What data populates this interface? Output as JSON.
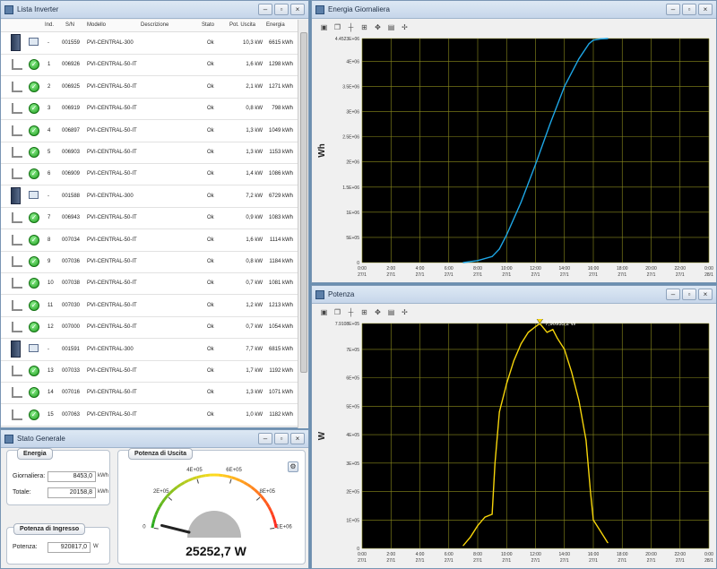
{
  "list_window": {
    "title": "Lista Inverter",
    "columns": {
      "ind": "Ind.",
      "sn": "S/N",
      "modello": "Modello",
      "descrizione": "Descrizione",
      "stato": "Stato",
      "pot": "Pot. Uscita",
      "energia": "Energia"
    },
    "rows": [
      {
        "type": "central",
        "ind": "-",
        "sn": "001559",
        "modello": "PVI-CENTRAL-300",
        "stato": "Ok",
        "pot": "10,3 kW",
        "energia": "6615 kWh"
      },
      {
        "type": "module",
        "ind": "1",
        "sn": "006926",
        "modello": "PVI-CENTRAL-50-IT",
        "stato": "Ok",
        "pot": "1,6 kW",
        "energia": "1298 kWh"
      },
      {
        "type": "module",
        "ind": "2",
        "sn": "006925",
        "modello": "PVI-CENTRAL-50-IT",
        "stato": "Ok",
        "pot": "2,1 kW",
        "energia": "1271 kWh"
      },
      {
        "type": "module",
        "ind": "3",
        "sn": "006919",
        "modello": "PVI-CENTRAL-50-IT",
        "stato": "Ok",
        "pot": "0,8 kW",
        "energia": "798 kWh"
      },
      {
        "type": "module",
        "ind": "4",
        "sn": "006897",
        "modello": "PVI-CENTRAL-50-IT",
        "stato": "Ok",
        "pot": "1,3 kW",
        "energia": "1049 kWh"
      },
      {
        "type": "module",
        "ind": "5",
        "sn": "006903",
        "modello": "PVI-CENTRAL-50-IT",
        "stato": "Ok",
        "pot": "1,3 kW",
        "energia": "1153 kWh"
      },
      {
        "type": "module",
        "ind": "6",
        "sn": "006909",
        "modello": "PVI-CENTRAL-50-IT",
        "stato": "Ok",
        "pot": "1,4 kW",
        "energia": "1086 kWh"
      },
      {
        "type": "central",
        "ind": "-",
        "sn": "001588",
        "modello": "PVI-CENTRAL-300",
        "stato": "Ok",
        "pot": "7,2 kW",
        "energia": "6729 kWh"
      },
      {
        "type": "module",
        "ind": "7",
        "sn": "006943",
        "modello": "PVI-CENTRAL-50-IT",
        "stato": "Ok",
        "pot": "0,9 kW",
        "energia": "1083 kWh"
      },
      {
        "type": "module",
        "ind": "8",
        "sn": "007034",
        "modello": "PVI-CENTRAL-50-IT",
        "stato": "Ok",
        "pot": "1,6 kW",
        "energia": "1114 kWh"
      },
      {
        "type": "module",
        "ind": "9",
        "sn": "007036",
        "modello": "PVI-CENTRAL-50-IT",
        "stato": "Ok",
        "pot": "0,8 kW",
        "energia": "1184 kWh"
      },
      {
        "type": "module",
        "ind": "10",
        "sn": "007038",
        "modello": "PVI-CENTRAL-50-IT",
        "stato": "Ok",
        "pot": "0,7 kW",
        "energia": "1081 kWh"
      },
      {
        "type": "module",
        "ind": "11",
        "sn": "007030",
        "modello": "PVI-CENTRAL-50-IT",
        "stato": "Ok",
        "pot": "1,2 kW",
        "energia": "1213 kWh"
      },
      {
        "type": "module",
        "ind": "12",
        "sn": "007000",
        "modello": "PVI-CENTRAL-50-IT",
        "stato": "Ok",
        "pot": "0,7 kW",
        "energia": "1054 kWh"
      },
      {
        "type": "central",
        "ind": "-",
        "sn": "001591",
        "modello": "PVI-CENTRAL-300",
        "stato": "Ok",
        "pot": "7,7 kW",
        "energia": "6815 kWh"
      },
      {
        "type": "module",
        "ind": "13",
        "sn": "007033",
        "modello": "PVI-CENTRAL-50-IT",
        "stato": "Ok",
        "pot": "1,7 kW",
        "energia": "1192 kWh"
      },
      {
        "type": "module",
        "ind": "14",
        "sn": "007016",
        "modello": "PVI-CENTRAL-50-IT",
        "stato": "Ok",
        "pot": "1,3 kW",
        "energia": "1071 kWh"
      },
      {
        "type": "module",
        "ind": "15",
        "sn": "007063",
        "modello": "PVI-CENTRAL-50-IT",
        "stato": "Ok",
        "pot": "1,0 kW",
        "energia": "1182 kWh"
      }
    ]
  },
  "stato_window": {
    "title": "Stato Generale",
    "energia": {
      "title": "Energia",
      "giornaliera_label": "Giornaliera:",
      "giornaliera_value": "8453,0",
      "giornaliera_unit": "kWh",
      "totale_label": "Totale:",
      "totale_value": "20158,8",
      "totale_unit": "kWh"
    },
    "ingresso": {
      "title": "Potenza di Ingresso",
      "potenza_label": "Potenza:",
      "potenza_value": "920817,0",
      "potenza_unit": "W"
    },
    "uscita": {
      "title": "Potenza di Uscita",
      "value_label": "25252,7 W",
      "gauge_value": 25252.7,
      "gauge_min": 0,
      "gauge_max": 1000000,
      "tick_labels": [
        "0",
        "2E+05",
        "4E+05",
        "6E+05",
        "8E+05",
        "1E+06"
      ]
    }
  },
  "energia_window": {
    "title": "Energia Giornaliera"
  },
  "potenza_window": {
    "title": "Potenza"
  },
  "chart_data": [
    {
      "type": "line",
      "ylabel": "Wh",
      "xlim": [
        "0:00 27/1",
        "0:00 28/1"
      ],
      "ylim": [
        0,
        4452300
      ],
      "y_tick_labels": [
        "4.4523E+06",
        "4E+06",
        "3.5E+06",
        "3E+06",
        "2.5E+06",
        "2E+06",
        "1.5E+06",
        "1E+06",
        "5E+05",
        "0"
      ],
      "x_tick_labels": [
        [
          "0:00",
          "27/1"
        ],
        [
          "2:00",
          "27/1"
        ],
        [
          "4:00",
          "27/1"
        ],
        [
          "6:00",
          "27/1"
        ],
        [
          "8:00",
          "27/1"
        ],
        [
          "10:00",
          "27/1"
        ],
        [
          "12:00",
          "27/1"
        ],
        [
          "14:00",
          "27/1"
        ],
        [
          "16:00",
          "27/1"
        ],
        [
          "18:00",
          "27/1"
        ],
        [
          "20:00",
          "27/1"
        ],
        [
          "22:00",
          "27/1"
        ],
        [
          "0:00",
          "28/1"
        ]
      ],
      "grid": true,
      "color": "#1ea7e6",
      "series": [
        {
          "x": [
            7.0,
            8.0,
            9.0,
            9.5,
            10.0,
            11.0,
            12.0,
            13.0,
            14.0,
            15.0,
            15.7,
            16.0,
            16.5,
            17.0
          ],
          "y": [
            0,
            40000,
            120000,
            270000,
            550000,
            1200000,
            1950000,
            2750000,
            3500000,
            4050000,
            4350000,
            4420000,
            4445000,
            4452300
          ]
        }
      ]
    },
    {
      "type": "line",
      "ylabel": "W",
      "xlim": [
        "0:00 27/1",
        "0:00 28/1"
      ],
      "ylim": [
        0,
        791080
      ],
      "y_tick_labels": [
        "7.9108E+05",
        "7E+05",
        "6E+05",
        "5E+05",
        "4E+05",
        "3E+05",
        "2E+05",
        "1E+05",
        "0"
      ],
      "x_tick_labels": [
        [
          "0:00",
          "27/1"
        ],
        [
          "2:00",
          "27/1"
        ],
        [
          "4:00",
          "27/1"
        ],
        [
          "6:00",
          "27/1"
        ],
        [
          "8:00",
          "27/1"
        ],
        [
          "10:00",
          "27/1"
        ],
        [
          "12:00",
          "27/1"
        ],
        [
          "14:00",
          "27/1"
        ],
        [
          "16:00",
          "27/1"
        ],
        [
          "18:00",
          "27/1"
        ],
        [
          "20:00",
          "27/1"
        ],
        [
          "22:00",
          "27/1"
        ],
        [
          "0:00",
          "28/1"
        ]
      ],
      "grid": true,
      "color": "#f5d40a",
      "marker_label": "7,90935,2 W",
      "series": [
        {
          "x": [
            7.0,
            7.5,
            8.0,
            8.5,
            9.0,
            9.2,
            9.5,
            10.0,
            10.5,
            11.0,
            11.5,
            12.0,
            12.3,
            12.8,
            13.2,
            13.5,
            14.0,
            14.5,
            15.0,
            15.5,
            15.8,
            16.0,
            16.5,
            17.0
          ],
          "y": [
            10000,
            40000,
            80000,
            110000,
            120000,
            300000,
            480000,
            580000,
            660000,
            720000,
            760000,
            780000,
            791000,
            760000,
            770000,
            740000,
            700000,
            620000,
            520000,
            380000,
            200000,
            100000,
            60000,
            20000
          ]
        }
      ]
    }
  ]
}
